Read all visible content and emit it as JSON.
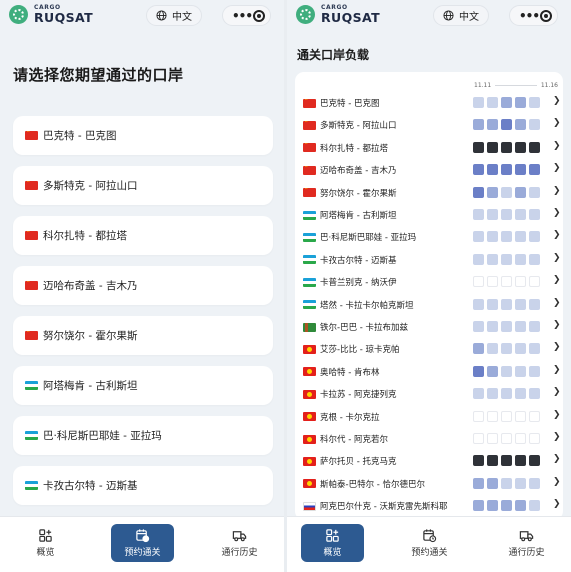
{
  "header": {
    "logo_small": "CARGO",
    "logo_big": "RUQSAT",
    "language": "中文"
  },
  "left": {
    "title": "请选择您期望通过的口岸",
    "items": [
      {
        "flag": "cn",
        "label": "巴克特 - 巴克图"
      },
      {
        "flag": "cn",
        "label": "多斯特克 - 阿拉山口"
      },
      {
        "flag": "cn",
        "label": "科尔扎特 - 都拉塔"
      },
      {
        "flag": "cn",
        "label": "迈哈布奇盖 - 吉木乃"
      },
      {
        "flag": "cn",
        "label": "努尔饶尔 - 霍尔果斯"
      },
      {
        "flag": "uz",
        "label": "阿塔梅肯 - 古利斯坦"
      },
      {
        "flag": "uz",
        "label": "巴·科尼斯巴耶娃 - 亚拉玛"
      },
      {
        "flag": "uz",
        "label": "卡孜古尔特 - 迈斯基"
      }
    ]
  },
  "right": {
    "title": "通关口岸负载",
    "date_start": "11.11",
    "date_end": "11.16",
    "rows": [
      {
        "flag": "cn",
        "label": "巴克特 - 巴克图",
        "levels": [
          1,
          1,
          2,
          2,
          1
        ]
      },
      {
        "flag": "cn",
        "label": "多斯特克 - 阿拉山口",
        "levels": [
          2,
          2,
          3,
          2,
          1
        ]
      },
      {
        "flag": "cn",
        "label": "科尔扎特 - 都拉塔",
        "levels": [
          4,
          4,
          4,
          4,
          4
        ]
      },
      {
        "flag": "cn",
        "label": "迈哈布奇盖 - 吉木乃",
        "levels": [
          3,
          3,
          3,
          3,
          3
        ]
      },
      {
        "flag": "cn",
        "label": "努尔饶尔 - 霍尔果斯",
        "levels": [
          3,
          2,
          1,
          2,
          1
        ]
      },
      {
        "flag": "uz",
        "label": "阿塔梅肯 - 古利斯坦",
        "levels": [
          1,
          1,
          1,
          1,
          1
        ]
      },
      {
        "flag": "uz",
        "label": "巴·科尼斯巴耶娃 - 亚拉玛",
        "levels": [
          1,
          1,
          1,
          1,
          1
        ]
      },
      {
        "flag": "uz",
        "label": "卡孜古尔特 - 迈斯基",
        "levels": [
          1,
          1,
          1,
          1,
          1
        ]
      },
      {
        "flag": "uz",
        "label": "卡普兰别克 - 纳沃伊",
        "levels": [
          0,
          0,
          0,
          0,
          0
        ]
      },
      {
        "flag": "uz",
        "label": "塔然 - 卡拉卡尔帕克斯坦",
        "levels": [
          1,
          1,
          1,
          1,
          1
        ]
      },
      {
        "flag": "tm",
        "label": "铁尔-巴巴 - 卡拉布加兹",
        "levels": [
          1,
          1,
          1,
          1,
          1
        ]
      },
      {
        "flag": "kg",
        "label": "艾莎-比比 - 琼卡克帕",
        "levels": [
          2,
          1,
          1,
          1,
          1
        ]
      },
      {
        "flag": "kg",
        "label": "奥哈特 - 肯布林",
        "levels": [
          3,
          2,
          1,
          1,
          1
        ]
      },
      {
        "flag": "kg",
        "label": "卡拉苏 - 阿克捷列克",
        "levels": [
          1,
          1,
          1,
          1,
          1
        ]
      },
      {
        "flag": "kg",
        "label": "克根 - 卡尔克拉",
        "levels": [
          0,
          0,
          0,
          0,
          0
        ]
      },
      {
        "flag": "kg",
        "label": "科尔代 - 阿克若尔",
        "levels": [
          0,
          0,
          0,
          0,
          0
        ]
      },
      {
        "flag": "kg",
        "label": "萨尔托贝 - 托克马克",
        "levels": [
          4,
          4,
          4,
          4,
          4
        ]
      },
      {
        "flag": "kg",
        "label": "斯帕泰-巴特尔 - 恰尔德巴尔",
        "levels": [
          2,
          2,
          1,
          1,
          1
        ]
      },
      {
        "flag": "ru",
        "label": "阿克巴尔什克 - 沃斯克雷先斯科耶",
        "levels": [
          2,
          2,
          2,
          2,
          1
        ]
      }
    ]
  },
  "colors": {
    "level": [
      "#ffffff",
      "#c9d3ea",
      "#9aabd9",
      "#6b7fc7",
      "#2f3238"
    ],
    "active_tab": "#2d5a91"
  },
  "nav": {
    "tabs": [
      {
        "label": "概览",
        "icon": "grid-plus-icon"
      },
      {
        "label": "预约通关",
        "icon": "calendar-clock-icon"
      },
      {
        "label": "通行历史",
        "icon": "truck-icon"
      }
    ],
    "left_active": 1,
    "right_active": 0
  }
}
